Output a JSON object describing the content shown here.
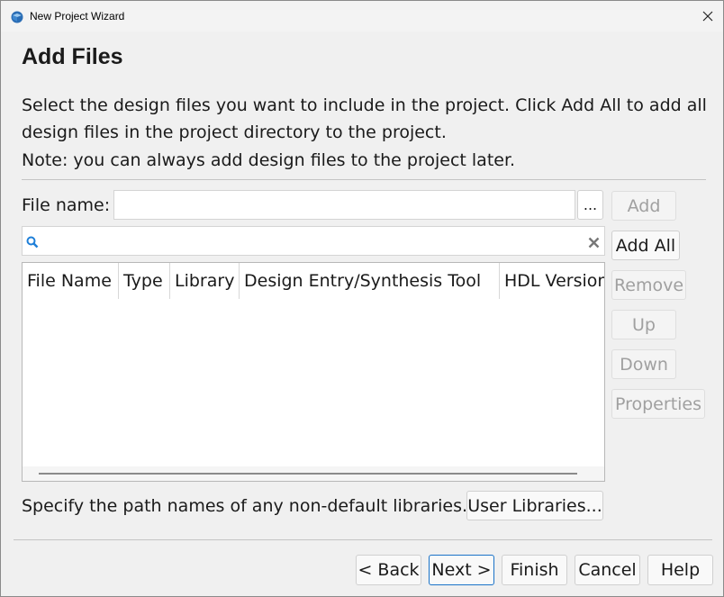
{
  "window": {
    "title": "New Project Wizard"
  },
  "page": {
    "title": "Add Files",
    "description": "Select the design files you want to include in the project. Click Add All to add all design files in the project directory to the project.",
    "note": "Note: you can always add design files to the project later."
  },
  "file_name": {
    "label": "File name:",
    "value": "",
    "browse_label": "..."
  },
  "search": {
    "value": ""
  },
  "side_buttons": {
    "add": "Add",
    "add_all": "Add All",
    "remove": "Remove",
    "up": "Up",
    "down": "Down",
    "properties": "Properties"
  },
  "table": {
    "columns": [
      "File Name",
      "Type",
      "Library",
      "Design Entry/Synthesis Tool",
      "HDL Version"
    ],
    "rows": []
  },
  "libraries": {
    "label": "Specify the path names of any non-default libraries.",
    "button": "User Libraries..."
  },
  "footer": {
    "back": "< Back",
    "next": "Next >",
    "finish": "Finish",
    "cancel": "Cancel",
    "help": "Help"
  },
  "colors": {
    "accent": "#1a73c8",
    "search_icon": "#1e7fd8"
  },
  "icons": {
    "title_icon": "app-logo-icon",
    "close": "close-icon",
    "search": "search-icon",
    "clear": "clear-icon"
  }
}
